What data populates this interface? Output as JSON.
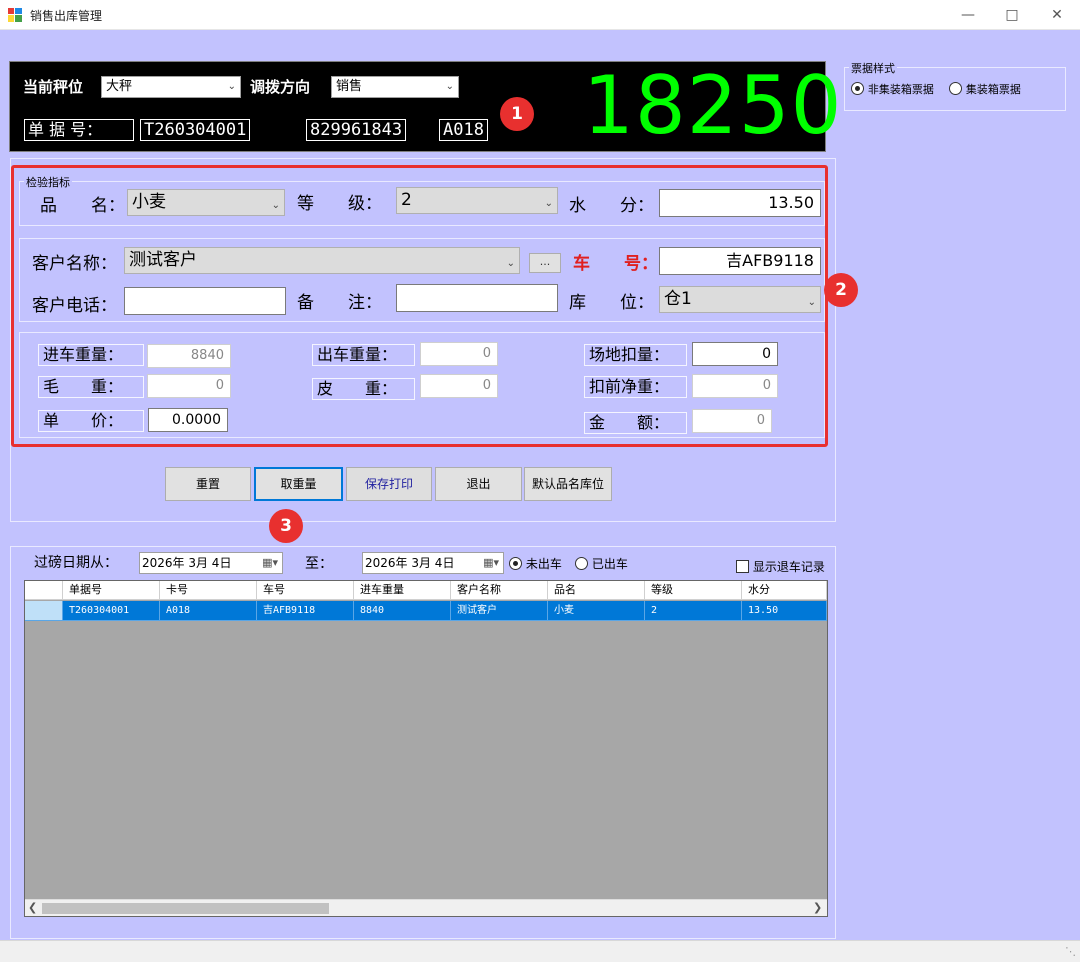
{
  "window": {
    "title": "销售出库管理"
  },
  "display": {
    "scale_label": "当前秤位",
    "scale_value": "大秤",
    "direction_label": "调拨方向",
    "direction_value": "销售",
    "doc_label": "单 据 号：",
    "doc_no": "T260304001",
    "card_no": "829961843",
    "code": "A018",
    "weight": "18250"
  },
  "badges": [
    "1",
    "2",
    "3"
  ],
  "ticket_style": {
    "legend": "票据样式",
    "options": [
      {
        "label": "非集装箱票据",
        "selected": true
      },
      {
        "label": "集装箱票据",
        "selected": false
      }
    ]
  },
  "form": {
    "inspection_legend": "检验指标",
    "product_label": "品　　名：",
    "product_value": "小麦",
    "grade_label": "等　　级：",
    "grade_value": "2",
    "moisture_label": "水　　分：",
    "moisture_value": "13.50",
    "customer_label": "客户名称：",
    "customer_value": "测试客户",
    "ellipsis": "...",
    "plate_label": "车　　号：",
    "plate_value": "吉AFB9118",
    "phone_label": "客户电话：",
    "phone_value": "",
    "remark_label": "备　　注：",
    "remark_value": "",
    "warehouse_label": "库　　位：",
    "warehouse_value": "仓1"
  },
  "weights": {
    "in_label": "进车重量：",
    "in_value": "8840",
    "out_label": "出车重量：",
    "out_value": "0",
    "site_deduct_label": "场地扣量：",
    "site_deduct_value": "0",
    "gross_label": "毛　　重：",
    "gross_value": "0",
    "tare_label": "皮　　重：",
    "tare_value": "0",
    "net_label": "扣前净重：",
    "net_value": "0",
    "price_label": "单　　价：",
    "price_value": "0.0000",
    "amount_label": "金　　额：",
    "amount_value": "0"
  },
  "buttons": {
    "reset": "重置",
    "get_weight": "取重量",
    "save_print": "保存打印",
    "exit": "退出",
    "default_loc": "默认品名库位"
  },
  "filter": {
    "date_from_label": "过磅日期从：",
    "date_from": "2026年  3月  4日",
    "to_label": "至：",
    "date_to": "2026年  3月  4日",
    "not_out_label": "未出车",
    "out_label": "已出车",
    "show_return_label": "显示退车记录"
  },
  "grid": {
    "columns": [
      "单据号",
      "卡号",
      "车号",
      "进车重量",
      "客户名称",
      "品名",
      "等级",
      "水分"
    ],
    "rows": [
      [
        "T260304001",
        "A018",
        "吉AFB9118",
        "8840",
        "测试客户",
        "小麦",
        "2",
        "13.50"
      ]
    ]
  }
}
